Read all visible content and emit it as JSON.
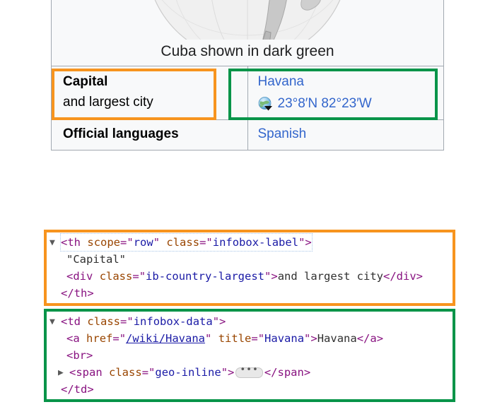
{
  "infobox": {
    "map_caption": "Cuba shown in dark green",
    "rows": [
      {
        "label_main": "Capital",
        "label_sub": "and largest city",
        "value_link": "Havana",
        "coords": "23°8′N 82°23′W",
        "geo_icon": "globe-arrow-icon",
        "highlight_label": "#f7941e",
        "highlight_data": "#089449"
      },
      {
        "label_main": "Official languages",
        "label_sub": "",
        "value_link": "Spanish",
        "coords": "",
        "geo_icon": "",
        "highlight_label": "",
        "highlight_data": ""
      }
    ]
  },
  "devtools": {
    "blocks": [
      {
        "border_color": "#f7941e",
        "lines": [
          {
            "twisty": "▼",
            "indent": "arrow",
            "selected": true,
            "tokens": [
              {
                "t": "punct",
                "s": "<"
              },
              {
                "t": "tag",
                "s": "th"
              },
              {
                "t": "txt",
                "s": " "
              },
              {
                "t": "attr",
                "s": "scope"
              },
              {
                "t": "punct",
                "s": "=\""
              },
              {
                "t": "val",
                "s": "row"
              },
              {
                "t": "punct",
                "s": "\""
              },
              {
                "t": "txt",
                "s": " "
              },
              {
                "t": "attr",
                "s": "class"
              },
              {
                "t": "punct",
                "s": "=\""
              },
              {
                "t": "val",
                "s": "infobox-label"
              },
              {
                "t": "punct",
                "s": "\">"
              }
            ]
          },
          {
            "twisty": "",
            "indent": "ind1",
            "selected": false,
            "tokens": [
              {
                "t": "txt",
                "s": "\"Capital\""
              }
            ]
          },
          {
            "twisty": "",
            "indent": "ind1",
            "selected": false,
            "tokens": [
              {
                "t": "punct",
                "s": "<"
              },
              {
                "t": "tag",
                "s": "div"
              },
              {
                "t": "txt",
                "s": " "
              },
              {
                "t": "attr",
                "s": "class"
              },
              {
                "t": "punct",
                "s": "=\""
              },
              {
                "t": "val",
                "s": "ib-country-largest"
              },
              {
                "t": "punct",
                "s": "\">"
              },
              {
                "t": "txt",
                "s": "and largest city"
              },
              {
                "t": "punct",
                "s": "</"
              },
              {
                "t": "tag",
                "s": "div"
              },
              {
                "t": "punct",
                "s": ">"
              }
            ]
          },
          {
            "twisty": "",
            "indent": "close",
            "selected": false,
            "tokens": [
              {
                "t": "punct",
                "s": "</"
              },
              {
                "t": "tag",
                "s": "th"
              },
              {
                "t": "punct",
                "s": ">"
              }
            ]
          }
        ]
      },
      {
        "border_color": "#089449",
        "lines": [
          {
            "twisty": "▼",
            "indent": "arrow",
            "selected": false,
            "tokens": [
              {
                "t": "punct",
                "s": "<"
              },
              {
                "t": "tag",
                "s": "td"
              },
              {
                "t": "txt",
                "s": " "
              },
              {
                "t": "attr",
                "s": "class"
              },
              {
                "t": "punct",
                "s": "=\""
              },
              {
                "t": "val",
                "s": "infobox-data"
              },
              {
                "t": "punct",
                "s": "\">"
              }
            ]
          },
          {
            "twisty": "",
            "indent": "ind1",
            "selected": false,
            "tokens": [
              {
                "t": "punct",
                "s": "<"
              },
              {
                "t": "tag",
                "s": "a"
              },
              {
                "t": "txt",
                "s": " "
              },
              {
                "t": "attr",
                "s": "href"
              },
              {
                "t": "punct",
                "s": "=\""
              },
              {
                "t": "lnk",
                "s": "/wiki/Havana"
              },
              {
                "t": "punct",
                "s": "\""
              },
              {
                "t": "txt",
                "s": " "
              },
              {
                "t": "attr",
                "s": "title"
              },
              {
                "t": "punct",
                "s": "=\""
              },
              {
                "t": "val",
                "s": "Havana"
              },
              {
                "t": "punct",
                "s": "\">"
              },
              {
                "t": "txt",
                "s": "Havana"
              },
              {
                "t": "punct",
                "s": "</"
              },
              {
                "t": "tag",
                "s": "a"
              },
              {
                "t": "punct",
                "s": ">"
              }
            ]
          },
          {
            "twisty": "",
            "indent": "ind1",
            "selected": false,
            "tokens": [
              {
                "t": "punct",
                "s": "<"
              },
              {
                "t": "tag",
                "s": "br"
              },
              {
                "t": "punct",
                "s": ">"
              }
            ]
          },
          {
            "twisty": "▶",
            "indent": "arrow2",
            "selected": false,
            "tokens": [
              {
                "t": "punct",
                "s": "<"
              },
              {
                "t": "tag",
                "s": "span"
              },
              {
                "t": "txt",
                "s": " "
              },
              {
                "t": "attr",
                "s": "class"
              },
              {
                "t": "punct",
                "s": "=\""
              },
              {
                "t": "val",
                "s": "geo-inline"
              },
              {
                "t": "punct",
                "s": "\">"
              },
              {
                "t": "badge",
                "s": "•••"
              },
              {
                "t": "punct",
                "s": "</"
              },
              {
                "t": "tag",
                "s": "span"
              },
              {
                "t": "punct",
                "s": ">"
              }
            ]
          },
          {
            "twisty": "",
            "indent": "close",
            "selected": false,
            "tokens": [
              {
                "t": "punct",
                "s": "</"
              },
              {
                "t": "tag",
                "s": "td"
              },
              {
                "t": "punct",
                "s": ">"
              }
            ]
          }
        ]
      }
    ]
  }
}
